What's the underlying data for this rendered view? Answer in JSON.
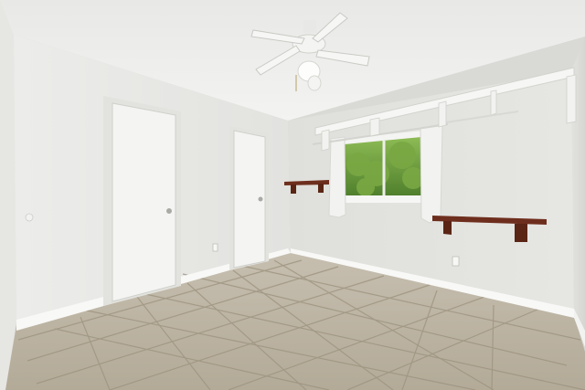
{
  "scene": {
    "kind": "photo",
    "colors": {
      "ceiling": "#eeeeec",
      "wall_left": "#e9e9e6",
      "wall_back": "#e3e3e0",
      "wall_right": "#dcdcd8",
      "door": "#f4f4f2",
      "baseboard": "#f7f7f5",
      "floor_tile": "#b9b09f",
      "grout": "#9a907f",
      "shelf_wood": "#6e2e1d",
      "window_green": "#6a9a3a",
      "curtain": "#f1f1ef",
      "fan_white": "#f5f5f3"
    }
  }
}
